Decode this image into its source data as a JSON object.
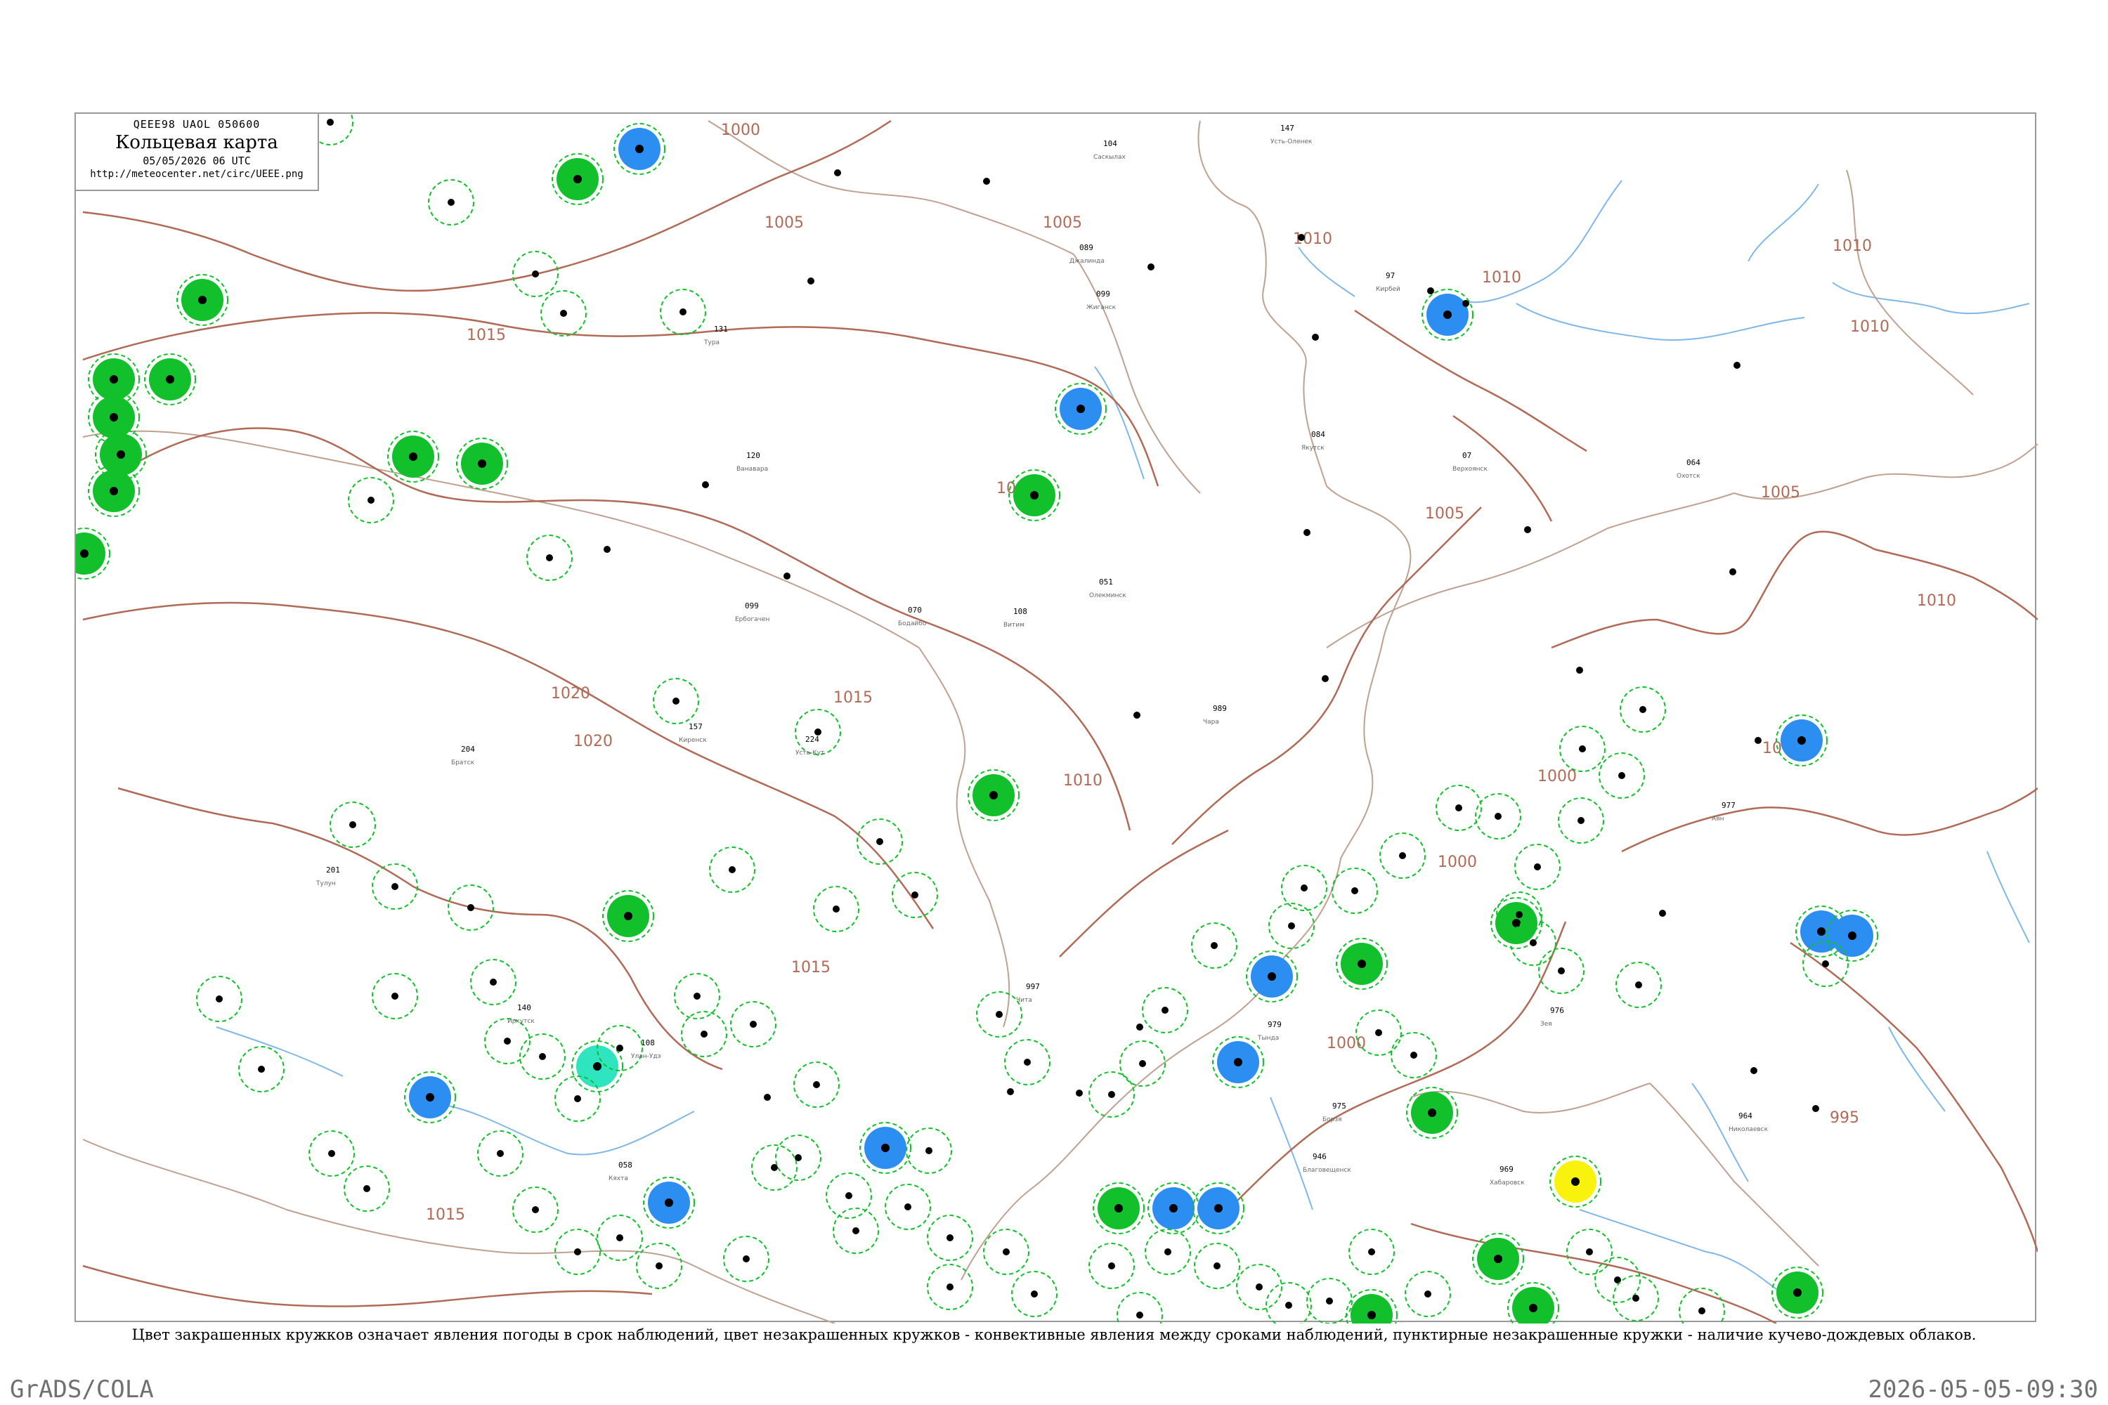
{
  "header": {
    "code": "QEEE98  UAOL  050600",
    "title": "Кольцевая карта",
    "datetime": "05/05/2026 06 UTC",
    "url": "http://meteocenter.net/circ/UEEE.png"
  },
  "legend": "Цвет закрашенных кружков означает явления погоды в срок наблюдений, цвет незакрашенных кружков - конвективные явления между сроками наблюдений, пунктирные незакрашенные кружки - наличие кучево-дождевых облаков.",
  "footer": {
    "left": "GrADS/COLA",
    "right": "2026-05-05-09:30"
  },
  "colors": {
    "rain_green": "#11c02b",
    "shower_blue": "#2b8ef0",
    "thunder_teal": "#2fe5c0",
    "fog_yellow": "#f8f20c",
    "isobar": "#b06a55",
    "river": "#7fb8e8",
    "ring": "#11c02b"
  },
  "isobar_labels": [
    "1005",
    "1000",
    "1005",
    "1005",
    "1010",
    "1010",
    "1010",
    "1010",
    "1015",
    "1010",
    "1005",
    "1005",
    "1010",
    "1015",
    "1020",
    "1020",
    "1015",
    "1010",
    "1000",
    "1000",
    "1005",
    "1000",
    "995",
    "1015"
  ],
  "stations": [
    {
      "name": "Кирбей",
      "obs": "97"
    },
    {
      "name": "Усть-Оленек",
      "obs": "147"
    },
    {
      "name": "Джалинда",
      "obs": "089"
    },
    {
      "name": "Саскылах",
      "obs": "104"
    },
    {
      "name": "Жиганск",
      "obs": "099"
    },
    {
      "name": "Верхоянск",
      "obs": "07"
    },
    {
      "name": "Якутск",
      "obs": "084"
    },
    {
      "name": "Олекминск",
      "obs": "051"
    },
    {
      "name": "Витим",
      "obs": "108"
    },
    {
      "name": "Бодайбо",
      "obs": "070"
    },
    {
      "name": "Чара",
      "obs": "989"
    },
    {
      "name": "Тында",
      "obs": "979"
    },
    {
      "name": "Тура",
      "obs": "131"
    },
    {
      "name": "Ванавара",
      "obs": "120"
    },
    {
      "name": "Ербогачен",
      "obs": "099"
    },
    {
      "name": "Киренск",
      "obs": "157"
    },
    {
      "name": "Усть-Кут",
      "obs": "224"
    },
    {
      "name": "Братск",
      "obs": "204"
    },
    {
      "name": "Тулун",
      "obs": "201"
    },
    {
      "name": "Иркутск",
      "obs": "140"
    },
    {
      "name": "Улан-Удэ",
      "obs": "108"
    },
    {
      "name": "Кяхта",
      "obs": "058"
    },
    {
      "name": "Чита",
      "obs": "997"
    },
    {
      "name": "Борзя",
      "obs": "975"
    },
    {
      "name": "Благовещенск",
      "obs": "946"
    },
    {
      "name": "Хабаровск",
      "obs": "969"
    },
    {
      "name": "Зея",
      "obs": "976"
    },
    {
      "name": "Охотск",
      "obs": "064"
    },
    {
      "name": "Аян",
      "obs": "977"
    },
    {
      "name": "Николаевск",
      "obs": "964"
    }
  ]
}
